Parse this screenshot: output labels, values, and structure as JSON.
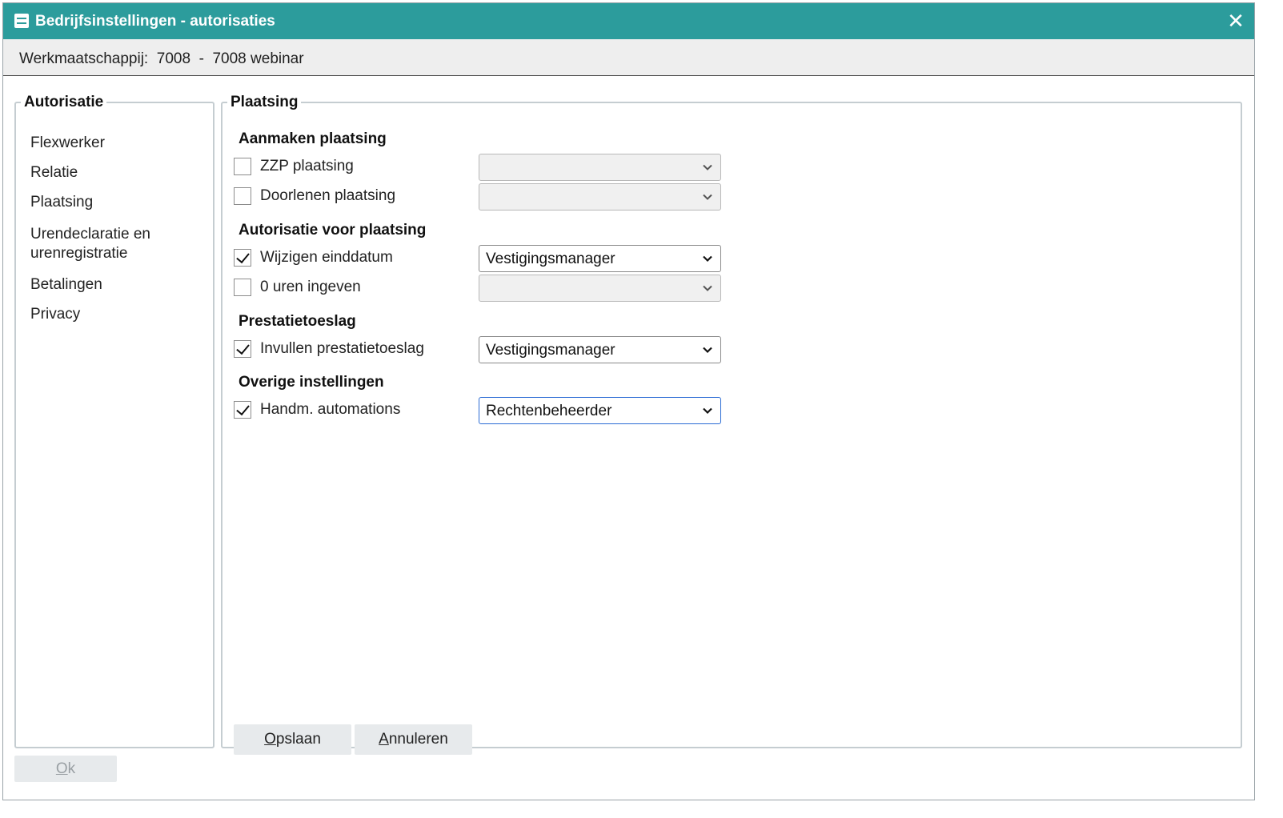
{
  "window": {
    "title": "Bedrijfsinstellingen - autorisaties",
    "title_icon": "settings-form-icon",
    "close_icon": "close-icon",
    "company_line": "Werkmaatschappij:  7008  -  7008 webinar"
  },
  "sidebar": {
    "legend": "Autorisatie",
    "items": [
      {
        "label": "Flexwerker"
      },
      {
        "label": "Relatie"
      },
      {
        "label": "Plaatsing"
      },
      {
        "label": "Urendeclaratie en urenregistratie"
      },
      {
        "label": "Betalingen"
      },
      {
        "label": "Privacy"
      }
    ]
  },
  "main": {
    "legend": "Plaatsing",
    "sections": [
      {
        "heading": "Aanmaken plaatsing",
        "rows": [
          {
            "label": "ZZP plaatsing",
            "checked": false,
            "value": ""
          },
          {
            "label": "Doorlenen plaatsing",
            "checked": false,
            "value": ""
          }
        ]
      },
      {
        "heading": "Autorisatie voor plaatsing",
        "rows": [
          {
            "label": "Wijzigen einddatum",
            "checked": true,
            "value": "Vestigingsmanager"
          },
          {
            "label": "0 uren ingeven",
            "checked": false,
            "value": ""
          }
        ]
      },
      {
        "heading": "Prestatietoeslag",
        "rows": [
          {
            "label": "Invullen prestatietoeslag",
            "checked": true,
            "value": "Vestigingsmanager"
          }
        ]
      },
      {
        "heading": "Overige instellingen",
        "rows": [
          {
            "label": "Handm. automations",
            "checked": true,
            "value": "Rechtenbeheerder"
          }
        ]
      }
    ]
  },
  "buttons": {
    "save_first": "O",
    "save_rest": "pslaan",
    "cancel_first": "A",
    "cancel_rest": "nnuleren",
    "ok_first": "O",
    "ok_rest": "k"
  },
  "colors": {
    "titlebar": "#2c9c9c",
    "focus_border": "#2b6cd4"
  }
}
